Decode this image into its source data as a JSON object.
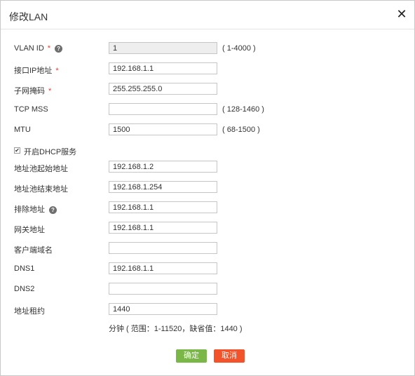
{
  "dialog": {
    "title": "修改LAN",
    "close_glyph": "✕"
  },
  "fields": {
    "vlan_id": {
      "label": "VLAN ID",
      "required": "*",
      "help": "?",
      "value": "1",
      "range": "( 1-4000 )"
    },
    "interface_ip": {
      "label": "接口IP地址",
      "required": "*",
      "value": "192.168.1.1"
    },
    "subnet_mask": {
      "label": "子网掩码",
      "required": "*",
      "value": "255.255.255.0"
    },
    "tcp_mss": {
      "label": "TCP MSS",
      "value": "",
      "range": "( 128-1460 )"
    },
    "mtu": {
      "label": "MTU",
      "value": "1500",
      "range": "( 68-1500 )"
    },
    "dhcp_enable": {
      "label": "开启DHCP服务",
      "checked": true,
      "check_glyph": "✔"
    },
    "pool_start": {
      "label": "地址池起始地址",
      "value": "192.168.1.2"
    },
    "pool_end": {
      "label": "地址池结束地址",
      "value": "192.168.1.254"
    },
    "exclude": {
      "label": "排除地址",
      "help": "?",
      "value": "192.168.1.1"
    },
    "gateway": {
      "label": "网关地址",
      "value": "192.168.1.1"
    },
    "client_domain": {
      "label": "客户端域名",
      "value": ""
    },
    "dns1": {
      "label": "DNS1",
      "value": "192.168.1.1"
    },
    "dns2": {
      "label": "DNS2",
      "value": ""
    },
    "lease": {
      "label": "地址租约",
      "value": "1440",
      "hint": "分钟 ( 范围：1-11520，缺省值：1440 )"
    }
  },
  "buttons": {
    "confirm": "确定",
    "cancel": "取消"
  },
  "colors": {
    "required": "#e23c2e",
    "confirm_button": "#7ab648",
    "cancel_button": "#f2532b"
  }
}
